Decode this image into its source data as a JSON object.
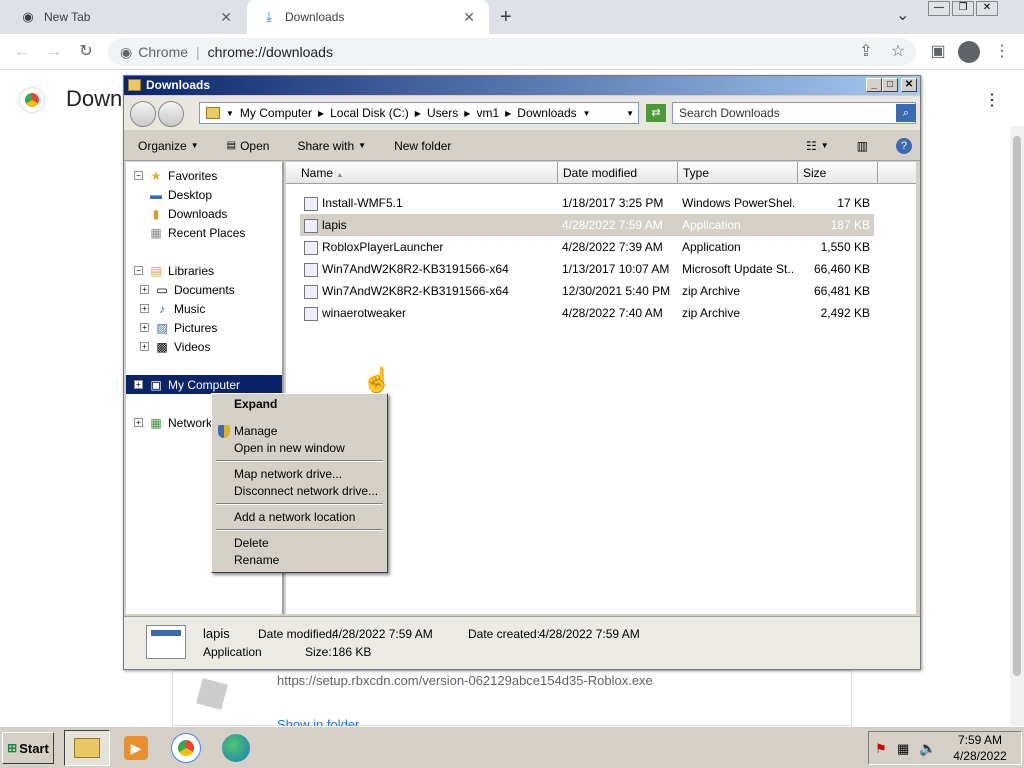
{
  "chrome": {
    "tabs": [
      {
        "label": "New Tab"
      },
      {
        "label": "Downloads"
      }
    ],
    "new_tab_symbol": "+",
    "tabs_menu_symbol": "⌄",
    "omnibox": {
      "site": "Chrome",
      "url": "chrome://downloads"
    },
    "page_title": "Down",
    "download_url": "https://setup.rbxcdn.com/version-062129abce154d35-Roblox.exe",
    "show_in_folder": "Show in folder"
  },
  "explorer": {
    "title": "Downloads",
    "breadcrumb": [
      "My Computer",
      "Local Disk (C:)",
      "Users",
      "vm1",
      "Downloads"
    ],
    "search_placeholder": "Search Downloads",
    "commands": {
      "organize": "Organize",
      "open": "Open",
      "share": "Share with",
      "new_folder": "New folder"
    },
    "nav": {
      "favorites": "Favorites",
      "fav_items": [
        "Desktop",
        "Downloads",
        "Recent Places"
      ],
      "libraries": "Libraries",
      "lib_items": [
        "Documents",
        "Music",
        "Pictures",
        "Videos"
      ],
      "my_computer": "My Computer",
      "network": "Network"
    },
    "columns": {
      "name": "Name",
      "date": "Date modified",
      "type": "Type",
      "size": "Size"
    },
    "files": [
      {
        "name": "Install-WMF5.1",
        "date": "1/18/2017 3:25 PM",
        "type": "Windows PowerShel...",
        "size": "17 KB"
      },
      {
        "name": "lapis",
        "date": "4/28/2022 7:59 AM",
        "type": "Application",
        "size": "187 KB"
      },
      {
        "name": "RobloxPlayerLauncher",
        "date": "4/28/2022 7:39 AM",
        "type": "Application",
        "size": "1,550 KB"
      },
      {
        "name": "Win7AndW2K8R2-KB3191566-x64",
        "date": "1/13/2017 10:07 AM",
        "type": "Microsoft Update St...",
        "size": "66,460 KB"
      },
      {
        "name": "Win7AndW2K8R2-KB3191566-x64",
        "date": "12/30/2021 5:40 PM",
        "type": "zip Archive",
        "size": "66,481 KB"
      },
      {
        "name": "winaerotweaker",
        "date": "4/28/2022 7:40 AM",
        "type": "zip Archive",
        "size": "2,492 KB"
      }
    ],
    "details": {
      "name": "lapis",
      "kind": "Application",
      "modified_label": "Date modified:",
      "modified": "4/28/2022 7:59 AM",
      "created_label": "Date created:",
      "created": "4/28/2022 7:59 AM",
      "size_label": "Size:",
      "size": "186 KB"
    }
  },
  "context_menu": {
    "expand": "Expand",
    "manage": "Manage",
    "open_new_window": "Open in new window",
    "map_drive": "Map network drive...",
    "disconnect_drive": "Disconnect network drive...",
    "add_location": "Add a network location",
    "delete": "Delete",
    "rename": "Rename"
  },
  "taskbar": {
    "start": "Start",
    "time": "7:59 AM",
    "date": "4/28/2022"
  }
}
